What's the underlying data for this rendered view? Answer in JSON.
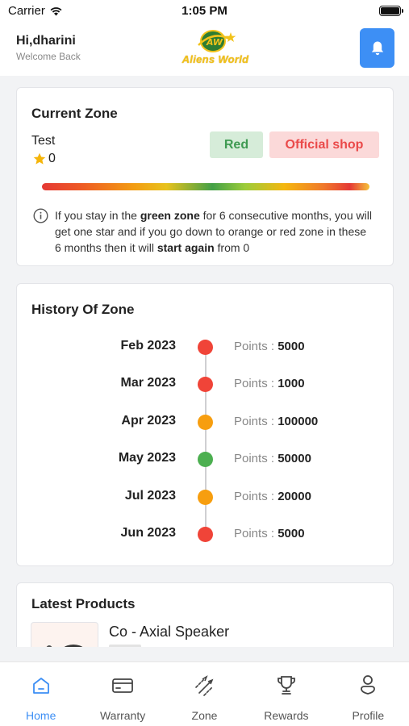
{
  "status_bar": {
    "carrier": "Carrier",
    "time": "1:05 PM"
  },
  "header": {
    "greeting": "Hi,dharini",
    "subtitle": "Welcome Back",
    "logo_text": "Aliens World",
    "accent_color": "#3d8ff5"
  },
  "current_zone": {
    "title": "Current Zone",
    "name": "Test",
    "stars": "0",
    "badge_zone": "Red",
    "badge_shop": "Official shop",
    "info_parts": {
      "p1": "If you stay in the ",
      "b1": "green zone",
      "p2": " for 6 consecutive months, you will get one star and if you go down to orange or red zone in these 6 months then it will ",
      "b2": "start again",
      "p3": " from 0"
    }
  },
  "history": {
    "title": "History Of Zone",
    "points_label": "Points : ",
    "rows": [
      {
        "month": "Feb 2023",
        "points": "5000",
        "color": "#f04438"
      },
      {
        "month": "Mar 2023",
        "points": "1000",
        "color": "#f04438"
      },
      {
        "month": "Apr 2023",
        "points": "100000",
        "color": "#f79e0f"
      },
      {
        "month": "May 2023",
        "points": "50000",
        "color": "#4caf50"
      },
      {
        "month": "Jul 2023",
        "points": "20000",
        "color": "#f79e0f"
      },
      {
        "month": "Jun 2023",
        "points": "5000",
        "color": "#f04438"
      }
    ]
  },
  "latest_products": {
    "title": "Latest Products",
    "product_name": "Co - Axial Speaker"
  },
  "nav": {
    "items": [
      {
        "label": "Home",
        "icon": "home-icon",
        "active": true
      },
      {
        "label": "Warranty",
        "icon": "card-icon",
        "active": false
      },
      {
        "label": "Zone",
        "icon": "zone-icon",
        "active": false
      },
      {
        "label": "Rewards",
        "icon": "trophy-icon",
        "active": false
      },
      {
        "label": "Profile",
        "icon": "profile-icon",
        "active": false
      }
    ]
  }
}
